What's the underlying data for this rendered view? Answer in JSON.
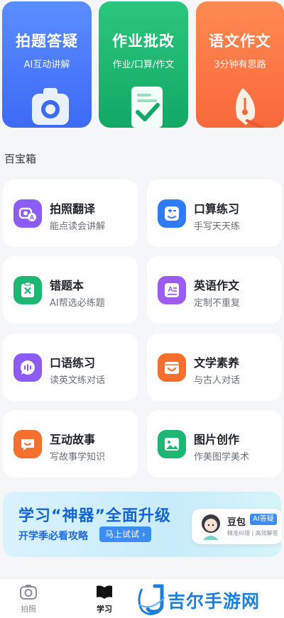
{
  "heroes": [
    {
      "title": "拍题答疑",
      "subtitle": "AI互动讲解",
      "icon": "camera-icon",
      "color": "#4a7bf9"
    },
    {
      "title": "作业批改",
      "subtitle": "作业/口算/作文",
      "icon": "checked-document-icon",
      "color": "#1db672"
    },
    {
      "title": "语文作文",
      "subtitle": "3分钟有思路",
      "icon": "fountain-pen-icon",
      "color": "#fb7644"
    }
  ],
  "toolbox": {
    "title": "百宝箱",
    "items": [
      {
        "title": "拍照翻译",
        "subtitle": "能点读会讲解",
        "icon": "photo-translate-icon",
        "color": "#8b5cf6"
      },
      {
        "title": "口算练习",
        "subtitle": "手写天天练",
        "icon": "math-practice-icon",
        "color": "#2f7bf5"
      },
      {
        "title": "错题本",
        "subtitle": "AI帮选必练题",
        "icon": "mistake-notebook-icon",
        "color": "#1db672"
      },
      {
        "title": "英语作文",
        "subtitle": "定制不重复",
        "icon": "english-essay-icon",
        "color": "#9b5cf0"
      },
      {
        "title": "口语练习",
        "subtitle": "读英文练对话",
        "icon": "speaking-practice-icon",
        "color": "#8b5cf6"
      },
      {
        "title": "文学素养",
        "subtitle": "与古人对话",
        "icon": "literature-icon",
        "color": "#f5702f"
      },
      {
        "title": "互动故事",
        "subtitle": "写故事学知识",
        "icon": "story-chat-icon",
        "color": "#f5702f"
      },
      {
        "title": "图片创作",
        "subtitle": "作美图学美术",
        "icon": "image-create-icon",
        "color": "#1db672"
      }
    ]
  },
  "banner": {
    "title": "学习“神器”全面升级",
    "subtitle": "开学季必看攻略",
    "button": "马上试试 ›",
    "assistant_name": "豆包",
    "assistant_badge": "AI答疑",
    "assistant_tags": "精准纠错 | 高效解答"
  },
  "tabs": [
    {
      "label": "拍照",
      "icon": "camera-icon",
      "active": false
    },
    {
      "label": "学习",
      "icon": "book-icon",
      "active": true
    }
  ],
  "watermark": "吉尔手游网"
}
